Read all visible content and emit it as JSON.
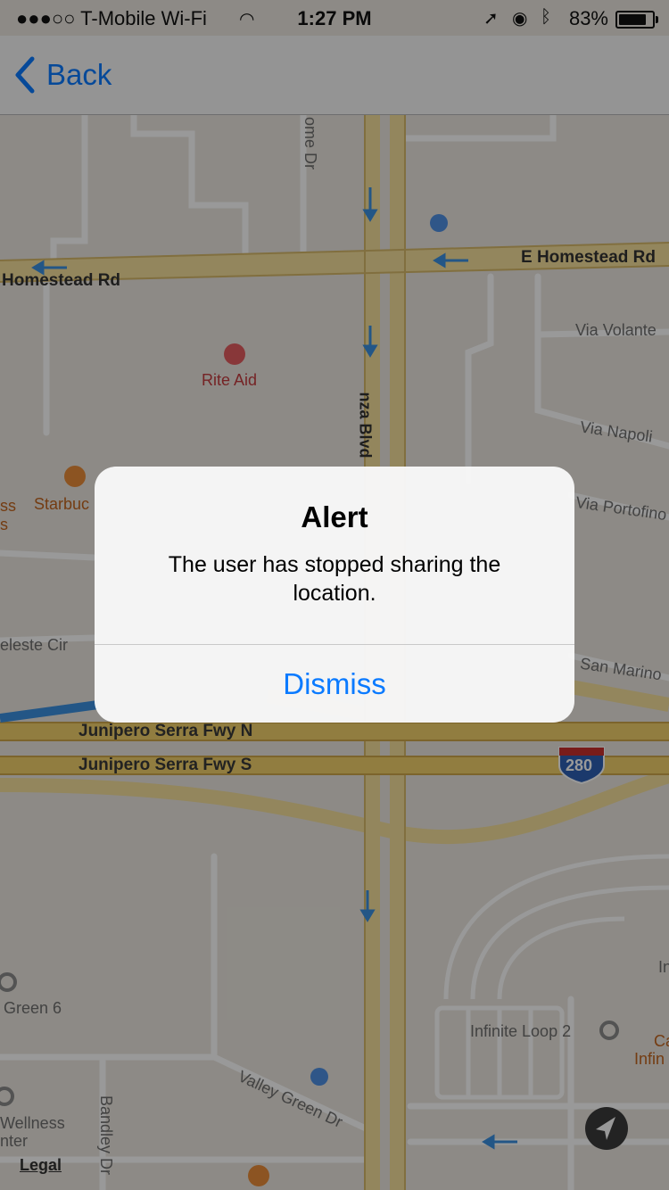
{
  "status_bar": {
    "carrier": "●●●○○ T-Mobile Wi-Fi",
    "time": "1:27 PM",
    "battery_percent": "83%",
    "battery_level": 0.83,
    "icons": [
      "wifi-icon",
      "location-arrow-icon",
      "alarm-icon",
      "bluetooth-icon",
      "battery-icon"
    ]
  },
  "nav": {
    "back_label": "Back",
    "back_icon": "chevron-left-icon",
    "accent_color": "#0a7aff"
  },
  "map": {
    "streets": {
      "homestead_w": "Homestead Rd",
      "homestead_e": "E Homestead Rd",
      "blvd": "nza Blvd",
      "ome_dr": "ome Dr",
      "via_volante": "Via Volante",
      "via_napoli": "Via Napoli",
      "via_portofino": "Via Portofino",
      "san_marino": "San Marino",
      "celeste": "eleste Cir",
      "fwy_n": "Junipero Serra Fwy N",
      "fwy_s": "Junipero Serra Fwy S",
      "valley_green": "Valley Green Dr",
      "bandley": "Bandley Dr"
    },
    "highway_shield": "280",
    "pois": {
      "rite_aid": "Rite Aid",
      "starbucks": "Starbuc",
      "left_partial_1": "ss",
      "left_partial_2": "s",
      "green6": "Green 6",
      "infinite_loop_2": "Infinite Loop 2",
      "wellness_1": "Wellness",
      "wellness_2": "nter",
      "right_partial_1": "Ca",
      "right_partial_2": "Infin",
      "right_partial_3": "In"
    },
    "legal": "Legal"
  },
  "alert": {
    "title": "Alert",
    "message": "The user has stopped sharing the location.",
    "dismiss_label": "Dismiss"
  }
}
